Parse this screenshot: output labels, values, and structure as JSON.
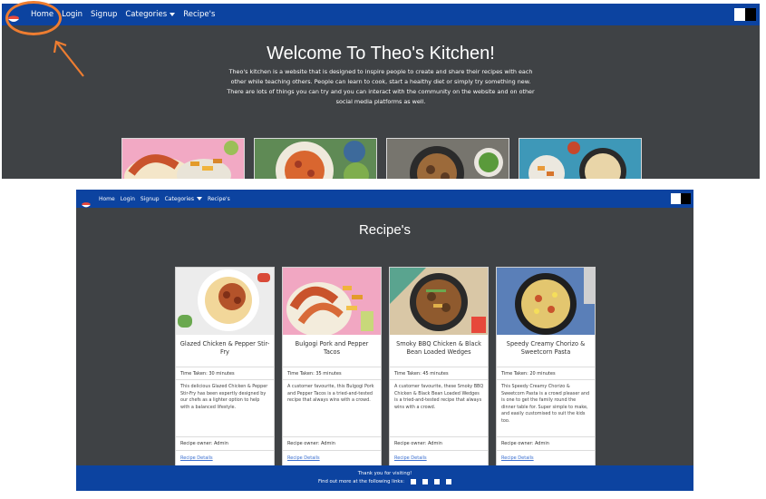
{
  "top_screenshot": {
    "nav": {
      "items": [
        "Home",
        "Login",
        "Signup",
        "Categories",
        "Recipe's"
      ],
      "logo_icon": "bowl-icon"
    },
    "hero": {
      "title": "Welcome To Theo's Kitchen!",
      "text": "Theo's kitchen is a website that is designed to inspire people to create and share their recipes with each other while teaching others. People can learn to cook, start a healthy diet or simply try something new. There are lots of things you can try and you can interact with the community on the website and on other social media platforms as well."
    }
  },
  "bottom_screenshot": {
    "nav": {
      "items": [
        "Home",
        "Login",
        "Signup",
        "Categories",
        "Recipe's"
      ]
    },
    "page_title": "Recipe's",
    "cards": [
      {
        "title": "Glazed Chicken & Pepper Stir-Fry",
        "time": "Time Taken: 30 minutes",
        "description": "This delicious Glazed Chicken & Pepper Stir-Fry has been expertly designed by our chefs as a lighter option to help with a balanced lifestyle.",
        "owner": "Recipe owner: Admin",
        "link": "Recipe Details"
      },
      {
        "title": "Bulgogi Pork and Pepper Tacos",
        "time": "Time Taken: 35 minutes",
        "description": "A customer favourite, this Bulgogi Pork and Pepper Tacos is a tried-and-tested recipe that always wins with a crowd.",
        "owner": "Recipe owner: Admin",
        "link": "Recipe Details"
      },
      {
        "title": "Smoky BBQ Chicken & Black Bean Loaded Wedges",
        "time": "Time Taken: 45 minutes",
        "description": "A customer favourite, these Smoky BBQ Chicken & Black Bean Loaded Wedges is a tried-and-tested recipe that always wins with a crowd.",
        "owner": "Recipe owner: Admin",
        "link": "Recipe Details"
      },
      {
        "title": "Speedy Creamy Chorizo & Sweetcorn Pasta",
        "time": "Time Taken: 20 minutes",
        "description": "This Speedy Creamy Chorizo & Sweetcorn Pasta is a crowd pleaser and is one to get the family round the dinner table for. Super simple to make, and easily customised to suit the kids too.",
        "owner": "Recipe owner: Admin",
        "link": "Recipe Details"
      }
    ],
    "footer": {
      "line1": "Thank you for visiting!",
      "line2": "Find out more at the following links:",
      "social_icons": [
        "facebook-icon",
        "twitter-icon",
        "instagram-icon",
        "youtube-icon"
      ]
    }
  },
  "colors": {
    "navbar": "#0c43a0",
    "background": "#3f4245",
    "annotation": "#ee7d31"
  }
}
